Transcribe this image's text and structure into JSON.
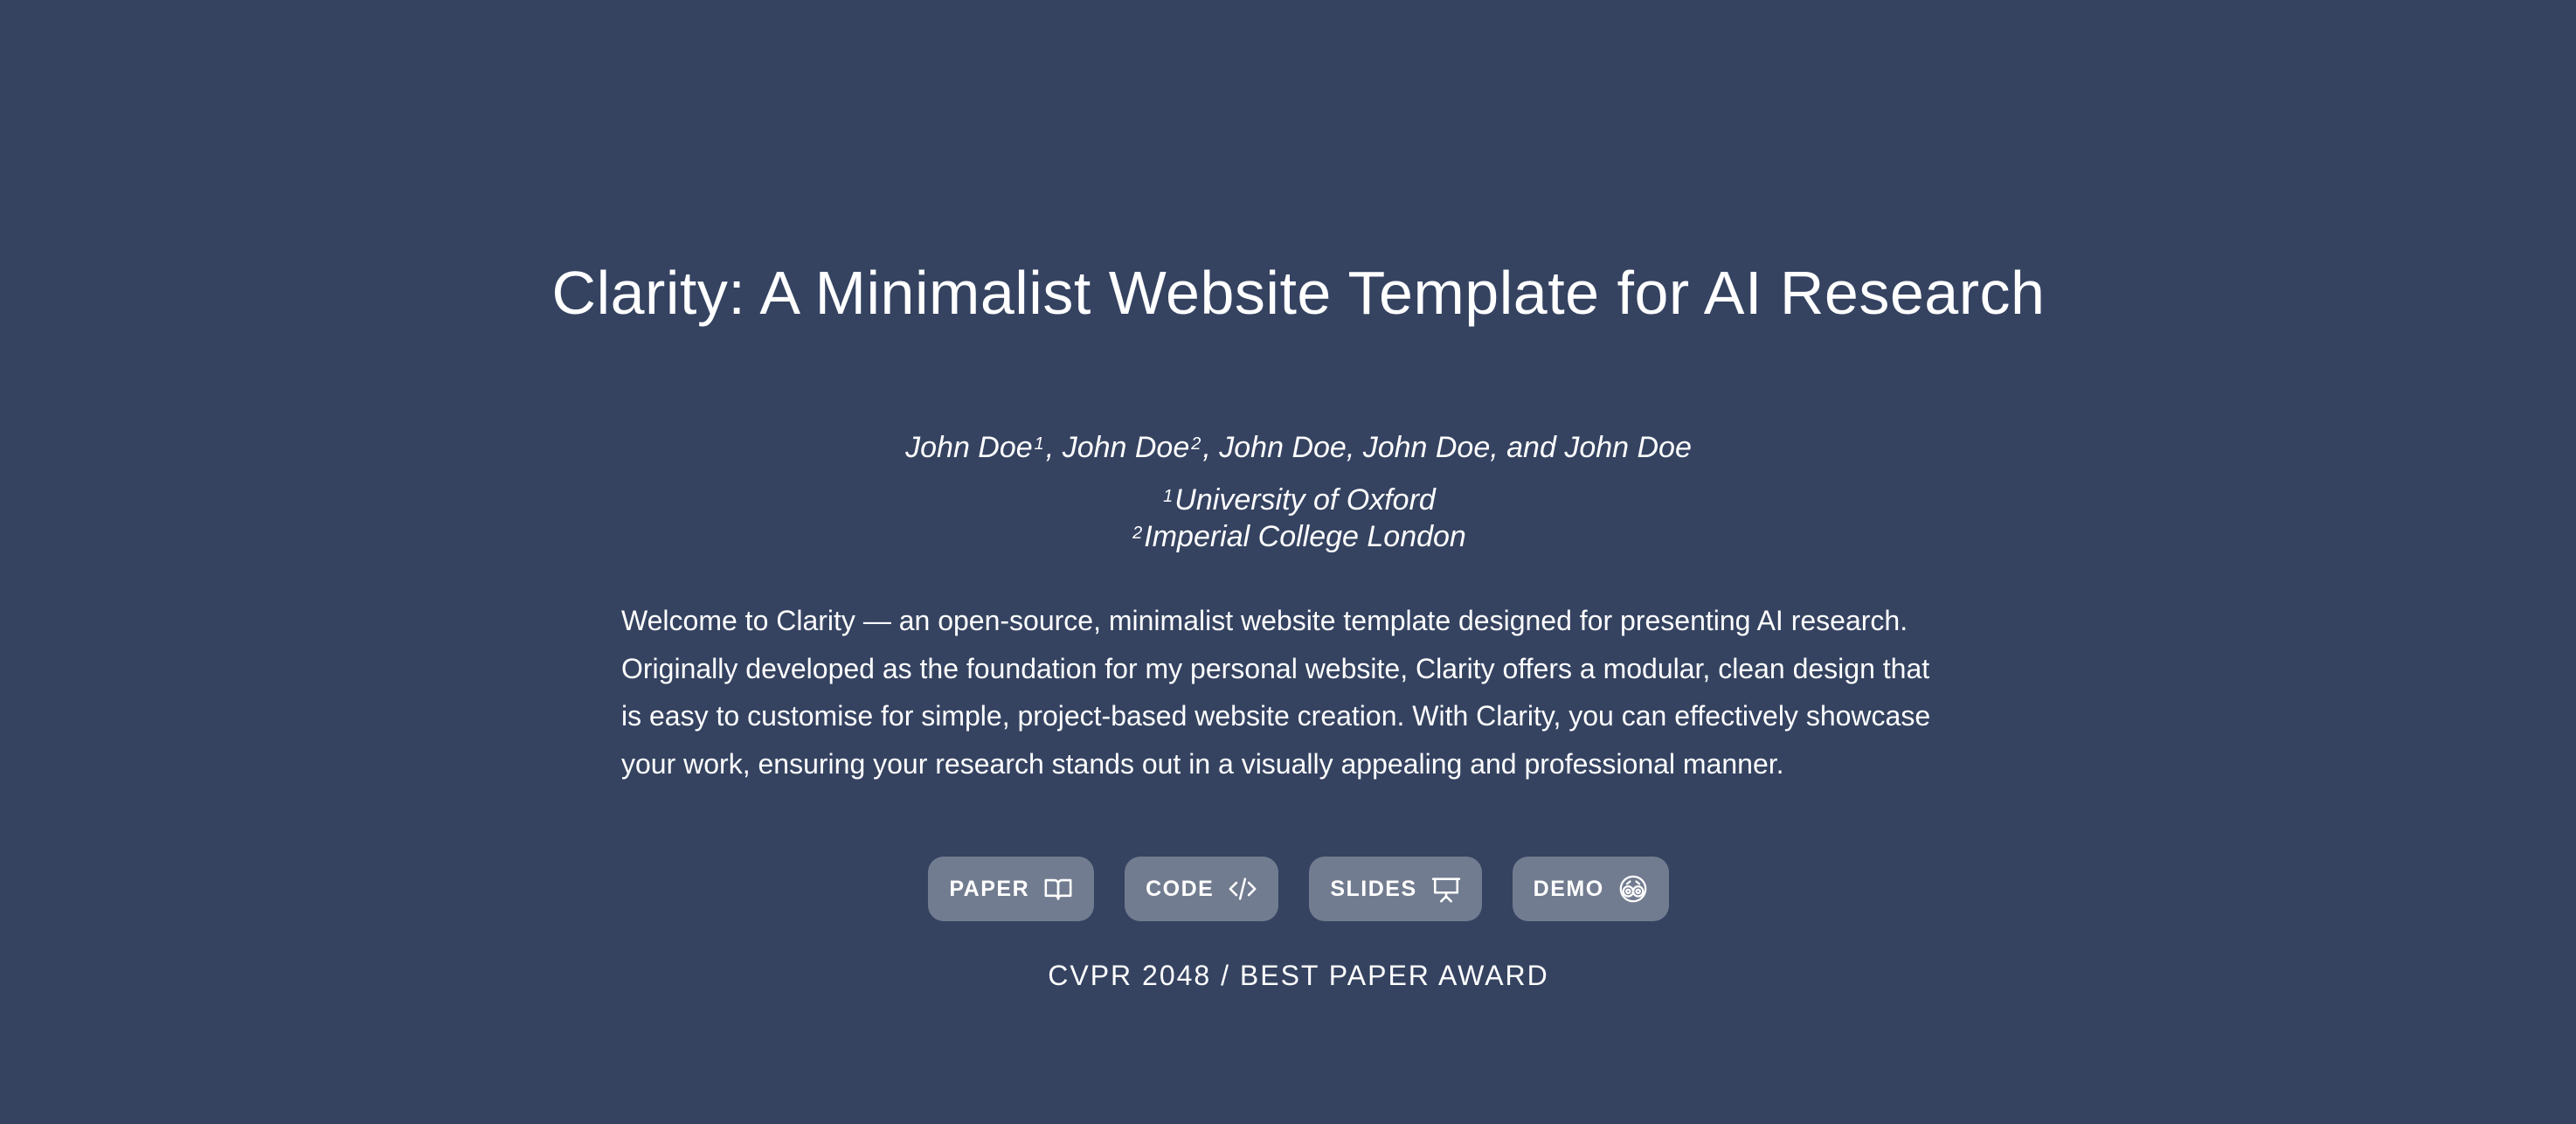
{
  "header": {
    "title": "Clarity: A Minimalist Website Template for AI Research"
  },
  "authors": {
    "a1_name": "John Doe",
    "a1_sup": "1",
    "a2_name": ", John Doe",
    "a2_sup": "2",
    "rest": ", John Doe, John Doe, and John Doe"
  },
  "affiliations": [
    {
      "sup": "1",
      "name": "University of Oxford"
    },
    {
      "sup": "2",
      "name": "Imperial College London"
    }
  ],
  "abstract": "Welcome to Clarity — an open-source, minimalist website template designed for presenting AI research. Originally developed as the foundation for my personal website, Clarity offers a modular, clean design that is easy to customise for simple, project-based website creation. With Clarity, you can effectively showcase your work, ensuring your research stands out in a visually appealing and professional manner.",
  "buttons": {
    "paper": {
      "label": "PAPER",
      "icon": "book-open-icon"
    },
    "code": {
      "label": "CODE",
      "icon": "code-icon"
    },
    "slides": {
      "label": "SLIDES",
      "icon": "presentation-icon"
    },
    "demo": {
      "label": "DEMO",
      "icon": "demo-icon"
    }
  },
  "venue": "CVPR 2048 / BEST PAPER AWARD",
  "colors": {
    "background": "#354361",
    "button": "#727c90",
    "text": "#ffffff"
  }
}
